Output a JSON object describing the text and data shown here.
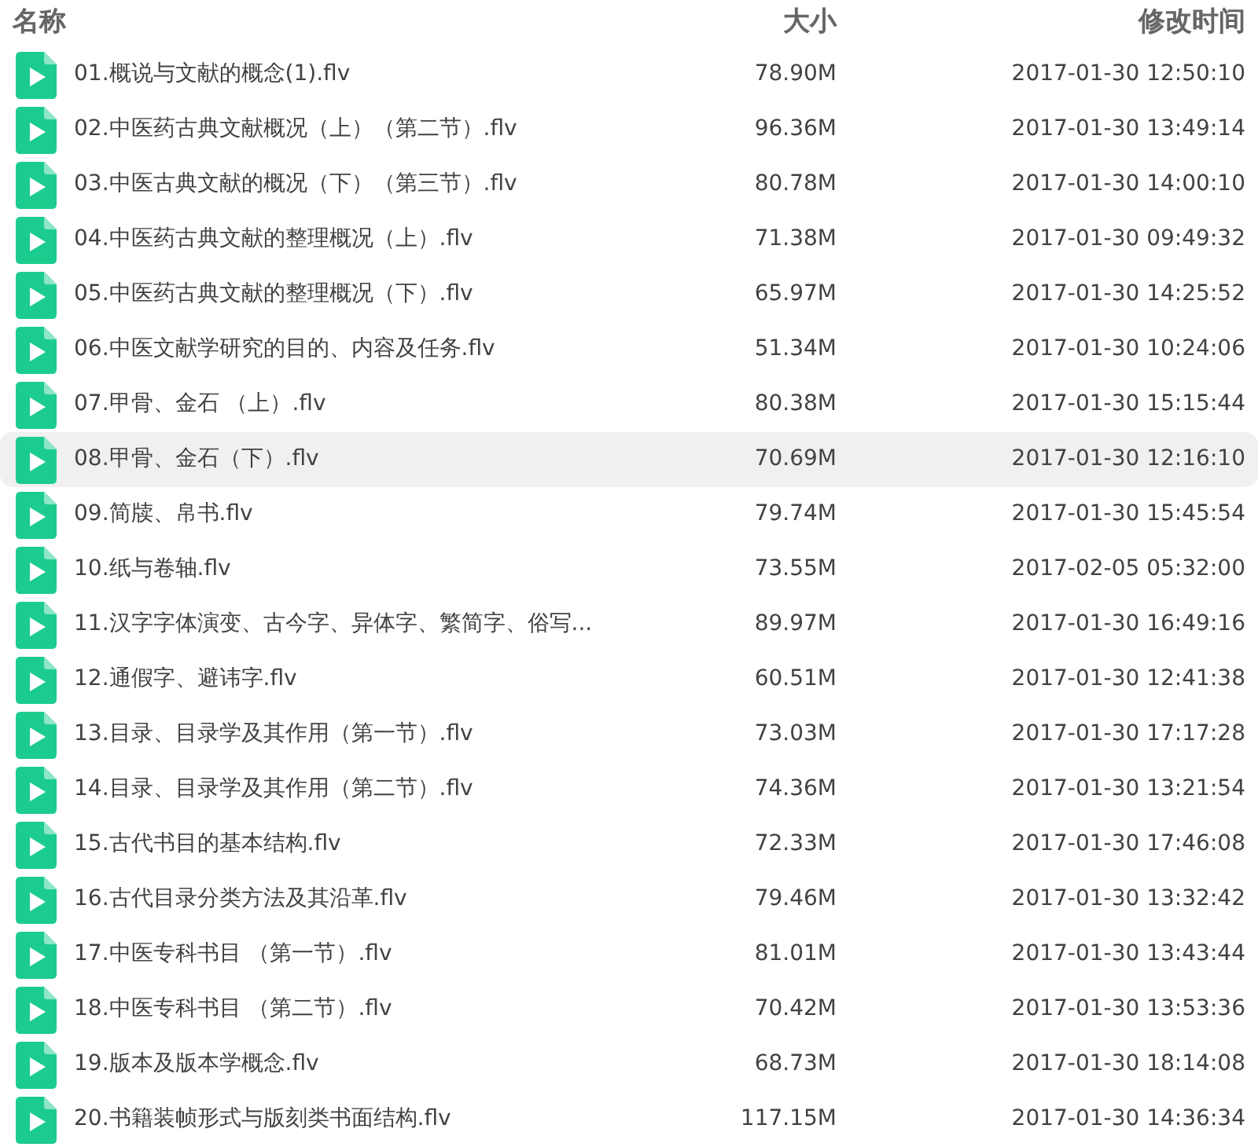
{
  "columns": [
    "名称",
    "大小",
    "修改时间"
  ],
  "files": [
    {
      "name": "01.概说与文献的概念(1).flv",
      "size": "78.90M",
      "modified": "2017-01-30 12:50:10",
      "selected": false
    },
    {
      "name": "02.中医药古典文献概况（上）（第二节）.flv",
      "size": "96.36M",
      "modified": "2017-01-30 13:49:14",
      "selected": false
    },
    {
      "name": "03.中医古典文献的概况（下）（第三节）.flv",
      "size": "80.78M",
      "modified": "2017-01-30 14:00:10",
      "selected": false
    },
    {
      "name": "04.中医药古典文献的整理概况（上）.flv",
      "size": "71.38M",
      "modified": "2017-01-30 09:49:32",
      "selected": false
    },
    {
      "name": "05.中医药古典文献的整理概况（下）.flv",
      "size": "65.97M",
      "modified": "2017-01-30 14:25:52",
      "selected": false
    },
    {
      "name": "06.中医文献学研究的目的、内容及任务.flv",
      "size": "51.34M",
      "modified": "2017-01-30 10:24:06",
      "selected": false
    },
    {
      "name": "07.甲骨、金石 （上）.flv",
      "size": "80.38M",
      "modified": "2017-01-30 15:15:44",
      "selected": false
    },
    {
      "name": "08.甲骨、金石（下）.flv",
      "size": "70.69M",
      "modified": "2017-01-30 12:16:10",
      "selected": true
    },
    {
      "name": "09.简牍、帛书.flv",
      "size": "79.74M",
      "modified": "2017-01-30 15:45:54",
      "selected": false
    },
    {
      "name": "10.纸与卷轴.flv",
      "size": "73.55M",
      "modified": "2017-02-05 05:32:00",
      "selected": false
    },
    {
      "name": "11.汉字字体演变、古今字、异体字、繁简字、俗写...",
      "size": "89.97M",
      "modified": "2017-01-30 16:49:16",
      "selected": false
    },
    {
      "name": "12.通假字、避讳字.flv",
      "size": "60.51M",
      "modified": "2017-01-30 12:41:38",
      "selected": false
    },
    {
      "name": "13.目录、目录学及其作用（第一节）.flv",
      "size": "73.03M",
      "modified": "2017-01-30 17:17:28",
      "selected": false
    },
    {
      "name": "14.目录、目录学及其作用（第二节）.flv",
      "size": "74.36M",
      "modified": "2017-01-30 13:21:54",
      "selected": false
    },
    {
      "name": "15.古代书目的基本结构.flv",
      "size": "72.33M",
      "modified": "2017-01-30 17:46:08",
      "selected": false
    },
    {
      "name": "16.古代目录分类方法及其沿革.flv",
      "size": "79.46M",
      "modified": "2017-01-30 13:32:42",
      "selected": false
    },
    {
      "name": "17.中医专科书目 （第一节）.flv",
      "size": "81.01M",
      "modified": "2017-01-30 13:43:44",
      "selected": false
    },
    {
      "name": "18.中医专科书目 （第二节）.flv",
      "size": "70.42M",
      "modified": "2017-01-30 13:53:36",
      "selected": false
    },
    {
      "name": "19.版本及版本学概念.flv",
      "size": "68.73M",
      "modified": "2017-01-30 18:14:08",
      "selected": false
    },
    {
      "name": "20.书籍装帧形式与版刻类书面结构.flv",
      "size": "117.15M",
      "modified": "2017-01-30 14:36:34",
      "selected": false
    }
  ]
}
